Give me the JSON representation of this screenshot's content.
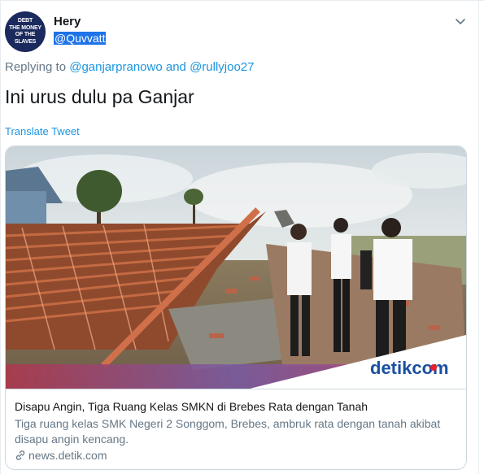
{
  "author": {
    "name": "Hery",
    "handle": "@Quvvatt",
    "avatar_text": [
      "DEBT",
      "THE MONEY",
      "OF THE",
      "SLAVES"
    ]
  },
  "reply": {
    "prefix": "Replying to",
    "mention1": "@ganjarpranowo",
    "joiner": "and",
    "mention2": "@rullyjoo27"
  },
  "tweet": {
    "text": "Ini urus dulu pa Ganjar",
    "translate_label": "Translate Tweet"
  },
  "card": {
    "image_logo_text": "detikcom",
    "title": "Disapu Angin, Tiga Ruang Kelas SMKN di Brebes Rata dengan Tanah",
    "description": "Tiga ruang kelas SMK Negeri 2 Songgom, Brebes, ambruk rata dengan tanah akibat disapu angin kencang.",
    "domain": "news.detik.com"
  },
  "colors": {
    "link": "#1b95e0",
    "secondary_text": "#657786",
    "selection": "#1e73e8",
    "detik_blue": "#1a4fa0",
    "detik_red": "#e8212e"
  }
}
